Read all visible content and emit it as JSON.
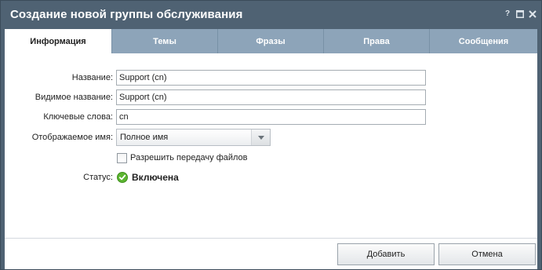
{
  "window": {
    "title": "Создание новой группы обслуживания",
    "controls": {
      "help": "?",
      "maximize_icon": "maximize-icon",
      "close_icon": "close-icon"
    }
  },
  "tabs": [
    {
      "label": "Информация",
      "active": true
    },
    {
      "label": "Темы",
      "active": false
    },
    {
      "label": "Фразы",
      "active": false
    },
    {
      "label": "Права",
      "active": false
    },
    {
      "label": "Сообщения",
      "active": false
    }
  ],
  "form": {
    "name": {
      "label": "Название:",
      "value": "Support (cn)"
    },
    "visible_name": {
      "label": "Видимое название:",
      "value": "Support (cn)"
    },
    "keywords": {
      "label": "Ключевые слова:",
      "value": "cn"
    },
    "display_name": {
      "label": "Отображаемое имя:",
      "selected": "Полное имя",
      "icon": "chevron-down-icon"
    },
    "allow_files": {
      "label": "Разрешить передачу файлов",
      "checked": false
    },
    "status": {
      "label": "Статус:",
      "value": "Включена",
      "icon": "check-circle-icon",
      "color": "#5cb531"
    }
  },
  "buttons": {
    "add": "Добавить",
    "cancel": "Отмена"
  },
  "colors": {
    "header": "#4f6273",
    "tab_inactive": "#8da4b9",
    "tab_active": "#ffffff"
  }
}
